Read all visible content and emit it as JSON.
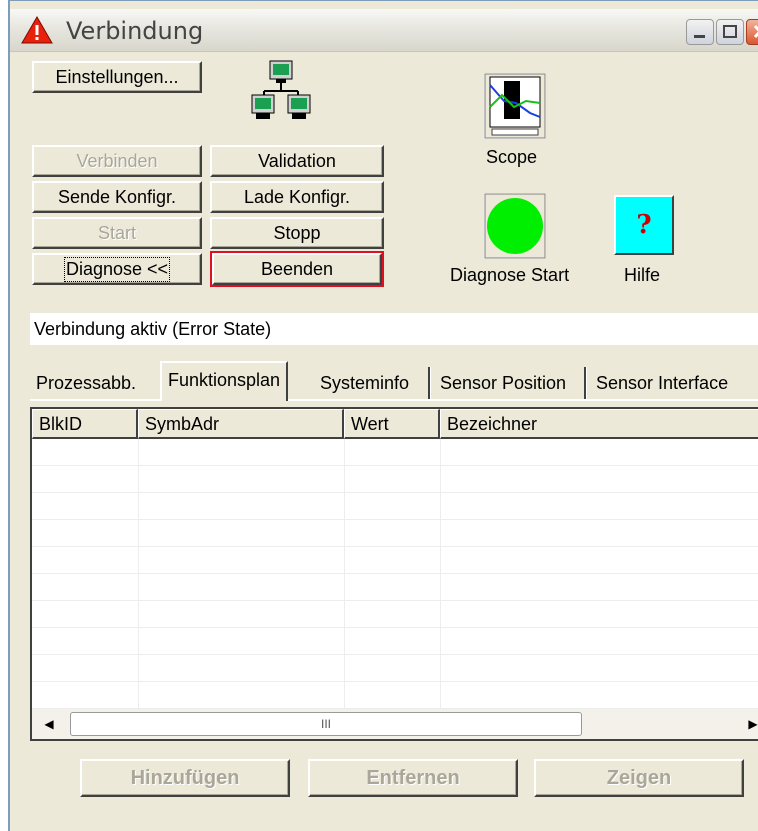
{
  "window": {
    "title": "Verbindung",
    "title_icon": "warning-triangle-icon"
  },
  "buttons": {
    "settings": "Einstellungen...",
    "connect": "Verbinden",
    "validation": "Validation",
    "send_config": "Sende Konfigr.",
    "load_config": "Lade Konfigr.",
    "start": "Start",
    "stop": "Stopp",
    "diagnose": "Diagnose <<",
    "quit": "Beenden",
    "add": "Hinzufügen",
    "remove": "Entfernen",
    "show": "Zeigen"
  },
  "tools": {
    "scope": "Scope",
    "diagnose_start": "Diagnose Start",
    "help": "Hilfe"
  },
  "status": "Verbindung aktiv (Error State)",
  "tabs": [
    "Prozessabb.",
    "Funktionsplan",
    "Systeminfo",
    "Sensor Position",
    "Sensor Interface"
  ],
  "active_tab": "Funktionsplan",
  "table": {
    "columns": [
      "BlkID",
      "SymbAdr",
      "Wert",
      "Bezeichner"
    ],
    "rows": []
  },
  "scrollbar": {
    "thumb_glyph": "III"
  },
  "colors": {
    "face": "#ece9d8",
    "diagnose_indicator": "#00ee00",
    "help_bg": "#00ffff",
    "help_fg": "#cc0000",
    "default_button_outline": "#e01020"
  }
}
